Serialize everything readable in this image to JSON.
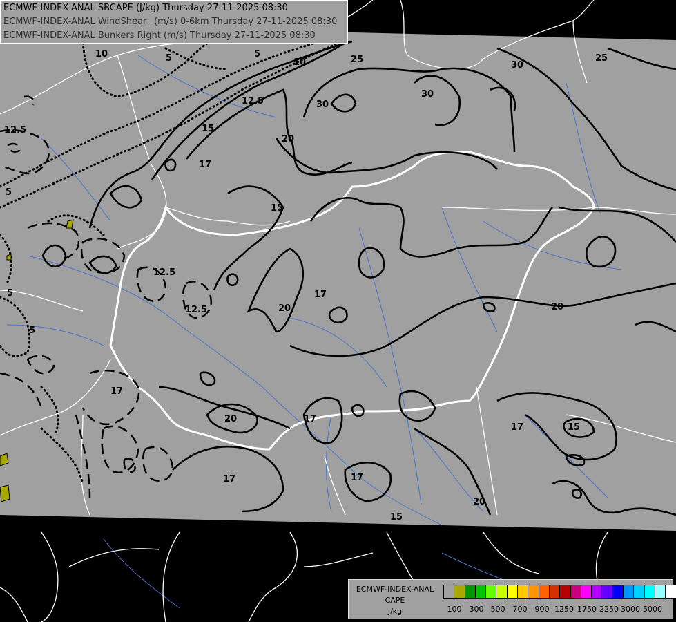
{
  "header": {
    "line1": "ECMWF-INDEX-ANAL SBCAPE (J/kg) Thursday 27-11-2025 08:30",
    "line2": "ECMWF-INDEX-ANAL WindShear_ (m/s) 0-6km Thursday 27-11-2025 08:30",
    "line3": "ECMWF-INDEX-ANAL Bunkers Right (m/s) Thursday 27-11-2025 08:30"
  },
  "legend": {
    "title_line1": "ECMWF-INDEX-ANAL",
    "title_line2": "CAPE",
    "title_line3": "J/kg",
    "colors": [
      "#a0a0a0",
      "#a8a800",
      "#009600",
      "#00c800",
      "#64ff00",
      "#c8ff00",
      "#ffff00",
      "#ffc800",
      "#ff9600",
      "#ff6400",
      "#d23200",
      "#b40000",
      "#c8007d",
      "#ff00ff",
      "#b400ff",
      "#6400ff",
      "#0000ff",
      "#0096ff",
      "#00d2ff",
      "#00ffff",
      "#96ffff",
      "#ffffff"
    ],
    "tick_labels": [
      "100",
      "300",
      "500",
      "700",
      "900",
      "1250",
      "1750",
      "2250",
      "3000",
      "5000"
    ]
  },
  "contour_labels": {
    "c1": "10",
    "c2": "5",
    "c3": "5",
    "c4": "12.5",
    "c5": "5",
    "c6": "10",
    "c7": "12.5",
    "c8": "15",
    "c9": "25",
    "c10": "30",
    "c11": "30",
    "c12": "30",
    "c13": "25",
    "c14": "20",
    "c15": "17",
    "c16": "15",
    "c17": "12.5",
    "c18": "12.5",
    "c19": "20",
    "c20": "17",
    "c21": "5",
    "c22": "5",
    "c23": "20",
    "c24": "17",
    "c25": "17",
    "c26": "20",
    "c27": "17",
    "c28": "15",
    "c29": "17",
    "c30": "17",
    "c31": "20",
    "c32": "15"
  }
}
